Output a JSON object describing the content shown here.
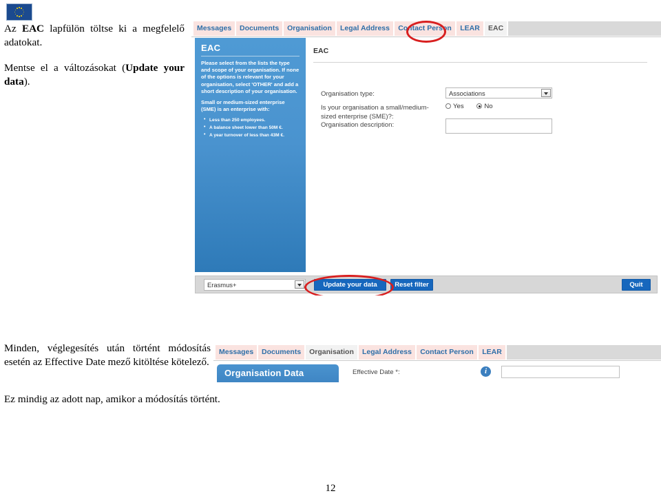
{
  "document": {
    "logo": "eu-flag-icon",
    "page_number": "12",
    "paragraph_1_prefix": "Az ",
    "paragraph_1_bold": "EAC",
    "paragraph_1_suffix": " lapfülön töltse ki a megfelelő adatokat.",
    "paragraph_2_prefix": "Mentse el a változásokat (",
    "paragraph_2_bold": "Update your data",
    "paragraph_2_suffix": ").",
    "paragraph_3_prefix": "Minden, véglegesítés után történt módosítás esetén az ",
    "paragraph_3_mid": "Effective Date",
    "paragraph_3_suffix": " mező kitöltése kötelező.",
    "paragraph_4": "Ez mindig az adott nap, amikor a módosítás történt."
  },
  "screenshot_eac": {
    "tabs": [
      {
        "label": "Messages",
        "active": false
      },
      {
        "label": "Documents",
        "active": false
      },
      {
        "label": "Organisation",
        "active": false
      },
      {
        "label": "Legal Address",
        "active": false
      },
      {
        "label": "Contact Person",
        "active": false
      },
      {
        "label": "LEAR",
        "active": false
      },
      {
        "label": "EAC",
        "active": true
      }
    ],
    "info_panel": {
      "heading": "EAC",
      "paragraph_1": "Please select from the lists the type and scope of your organisation. If none of the options is relevant for your organisation, select 'OTHER' and add a short description of your organisation.",
      "paragraph_2": "Small or medium-sized enterprise (SME) is an enterprise with:",
      "bullets": [
        "Less than 250 employees.",
        "A balance sheet lower than 50M €.",
        "A year turnover of less than 43M €."
      ]
    },
    "form": {
      "title": "EAC",
      "org_type_label": "Organisation type:",
      "org_type_value": "Associations",
      "sme_label": "Is your organisation a small/medium-sized enterprise (SME)?:",
      "sme_yes_label": "Yes",
      "sme_no_label": "No",
      "sme_selected": "No",
      "org_desc_label": "Organisation description:",
      "org_desc_value": ""
    },
    "bottom_bar": {
      "programme_value": "Erasmus+",
      "update_label": "Update your data",
      "reset_label": "Reset filter",
      "quit_label": "Quit"
    },
    "annotation_color": "#d81f1f"
  },
  "screenshot_orgdata": {
    "tabs": [
      {
        "label": "Messages",
        "active": false
      },
      {
        "label": "Documents",
        "active": false
      },
      {
        "label": "Organisation",
        "active": true
      },
      {
        "label": "Legal Address",
        "active": false
      },
      {
        "label": "Contact Person",
        "active": false
      },
      {
        "label": "LEAR",
        "active": false
      }
    ],
    "section_button_label": "Organisation Data",
    "effective_date_label": "Effective Date *:",
    "effective_date_value": "",
    "info_icon": "info-icon"
  }
}
